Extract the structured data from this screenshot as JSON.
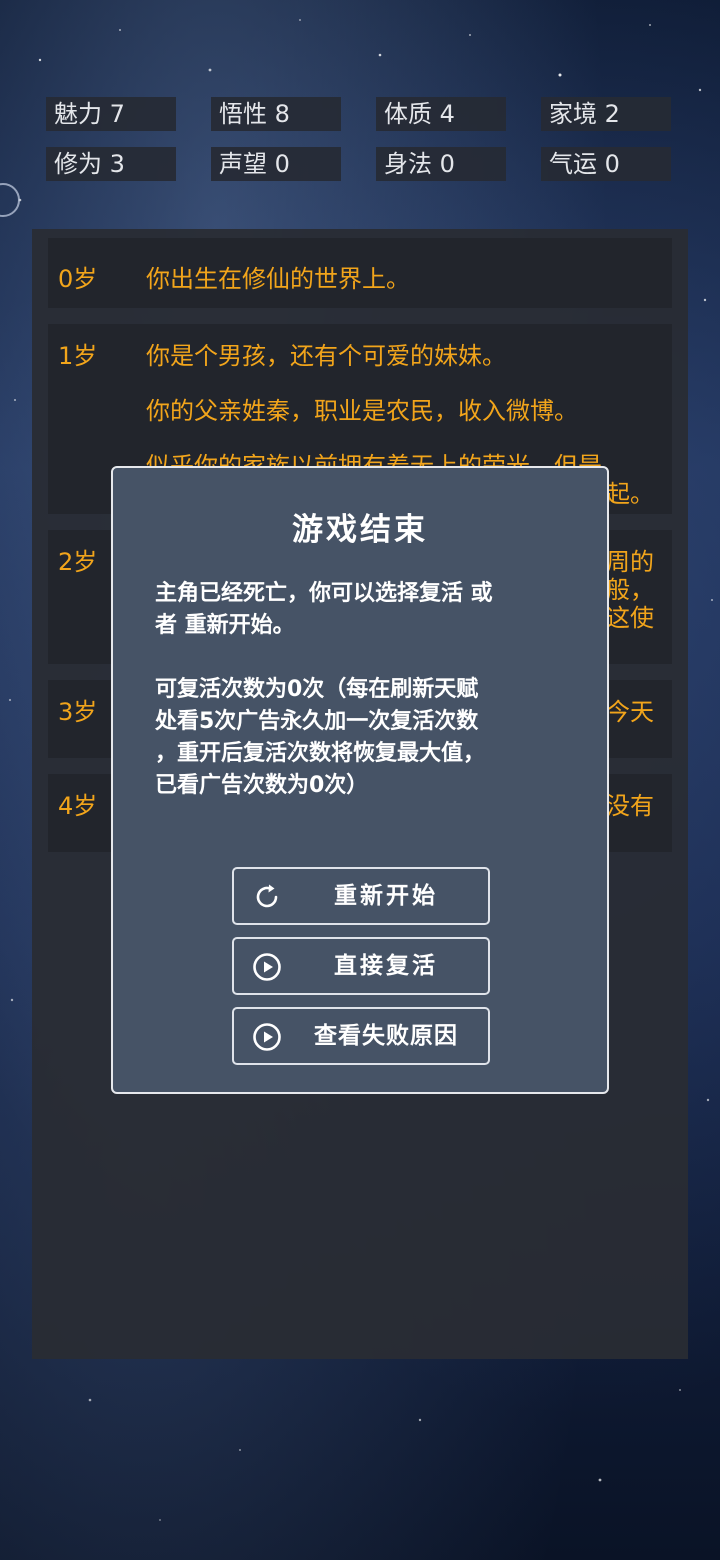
{
  "stats": [
    {
      "label": "魅力 7"
    },
    {
      "label": "悟性 8"
    },
    {
      "label": "体质 4"
    },
    {
      "label": "家境 2"
    },
    {
      "label": "修为 3"
    },
    {
      "label": "声望 0"
    },
    {
      "label": "身法 0"
    },
    {
      "label": "气运 0"
    }
  ],
  "log": [
    {
      "age": "0岁",
      "lines": [
        "你出生在修仙的世界上。"
      ]
    },
    {
      "age": "1岁",
      "lines": [
        "你是个男孩，还有个可爱的妹妹。",
        "你的父亲姓秦，职业是农民，收入微博。",
        "似乎你的家族以前拥有着无上的荣光，但是",
        "起。"
      ]
    },
    {
      "age": "2岁",
      "lines": [
        "周的",
        "般，",
        "这使"
      ]
    },
    {
      "age": "3岁",
      "lines": [
        "今天"
      ]
    },
    {
      "age": "4岁",
      "lines": [
        "没有"
      ]
    }
  ],
  "modal": {
    "title": "游戏结束",
    "text1_line1": "主角已经死亡，你可以选择复活 或",
    "text1_line2": "者 重新开始。",
    "text2_line1": "可复活次数为0次（每在刷新天赋",
    "text2_line2": "处看5次广告永久加一次复活次数",
    "text2_line3": "，重开后复活次数将恢复最大值，",
    "text2_line4": "已看广告次数为0次）",
    "restart_label": "重新开始",
    "revive_label": "直接复活",
    "reason_label": "查看失败原因"
  }
}
